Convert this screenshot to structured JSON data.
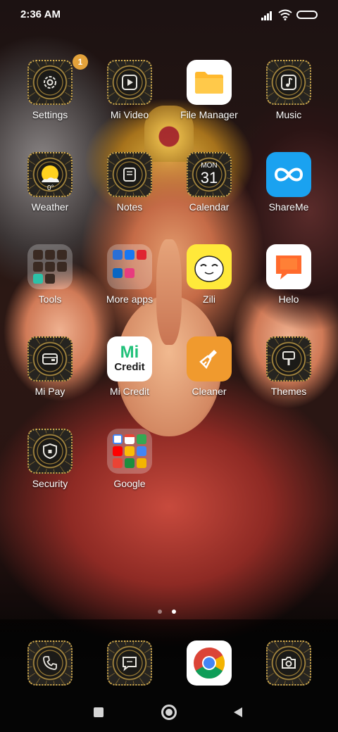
{
  "status_bar": {
    "time": "2:36 AM"
  },
  "apps": [
    {
      "id": "settings",
      "label": "Settings",
      "badge": "1"
    },
    {
      "id": "mi-video",
      "label": "Mi Video"
    },
    {
      "id": "file-manager",
      "label": "File Manager"
    },
    {
      "id": "music",
      "label": "Music"
    },
    {
      "id": "weather",
      "label": "Weather",
      "temp": "0°"
    },
    {
      "id": "notes",
      "label": "Notes"
    },
    {
      "id": "calendar",
      "label": "Calendar",
      "month": "MON",
      "day": "31"
    },
    {
      "id": "shareme",
      "label": "ShareMe"
    },
    {
      "id": "tools",
      "label": "Tools"
    },
    {
      "id": "more-apps",
      "label": "More apps"
    },
    {
      "id": "zili",
      "label": "Zili"
    },
    {
      "id": "helo",
      "label": "Helo"
    },
    {
      "id": "mi-pay",
      "label": "Mi Pay"
    },
    {
      "id": "mi-credit",
      "label": "Mi Credit",
      "icon_line1": "Mi",
      "icon_line2": "Credit"
    },
    {
      "id": "cleaner",
      "label": "Cleaner"
    },
    {
      "id": "themes",
      "label": "Themes"
    },
    {
      "id": "security",
      "label": "Security"
    },
    {
      "id": "google",
      "label": "Google"
    }
  ],
  "dock": [
    {
      "id": "phone",
      "icon": "phone-icon"
    },
    {
      "id": "messages",
      "icon": "message-icon"
    },
    {
      "id": "chrome",
      "icon": "chrome-icon"
    },
    {
      "id": "camera",
      "icon": "camera-icon"
    }
  ],
  "pages": {
    "count": 2,
    "current": 2
  },
  "colors": {
    "badge": "#e3a23b",
    "gold": "#cfa94e",
    "file_manager": "#ffb92e",
    "shareme": "#1aa2f0",
    "zili": "#ffe93a",
    "helo": "#ff6a2c",
    "cleaner": "#f09a2e",
    "mi_credit": "#22c17a"
  }
}
